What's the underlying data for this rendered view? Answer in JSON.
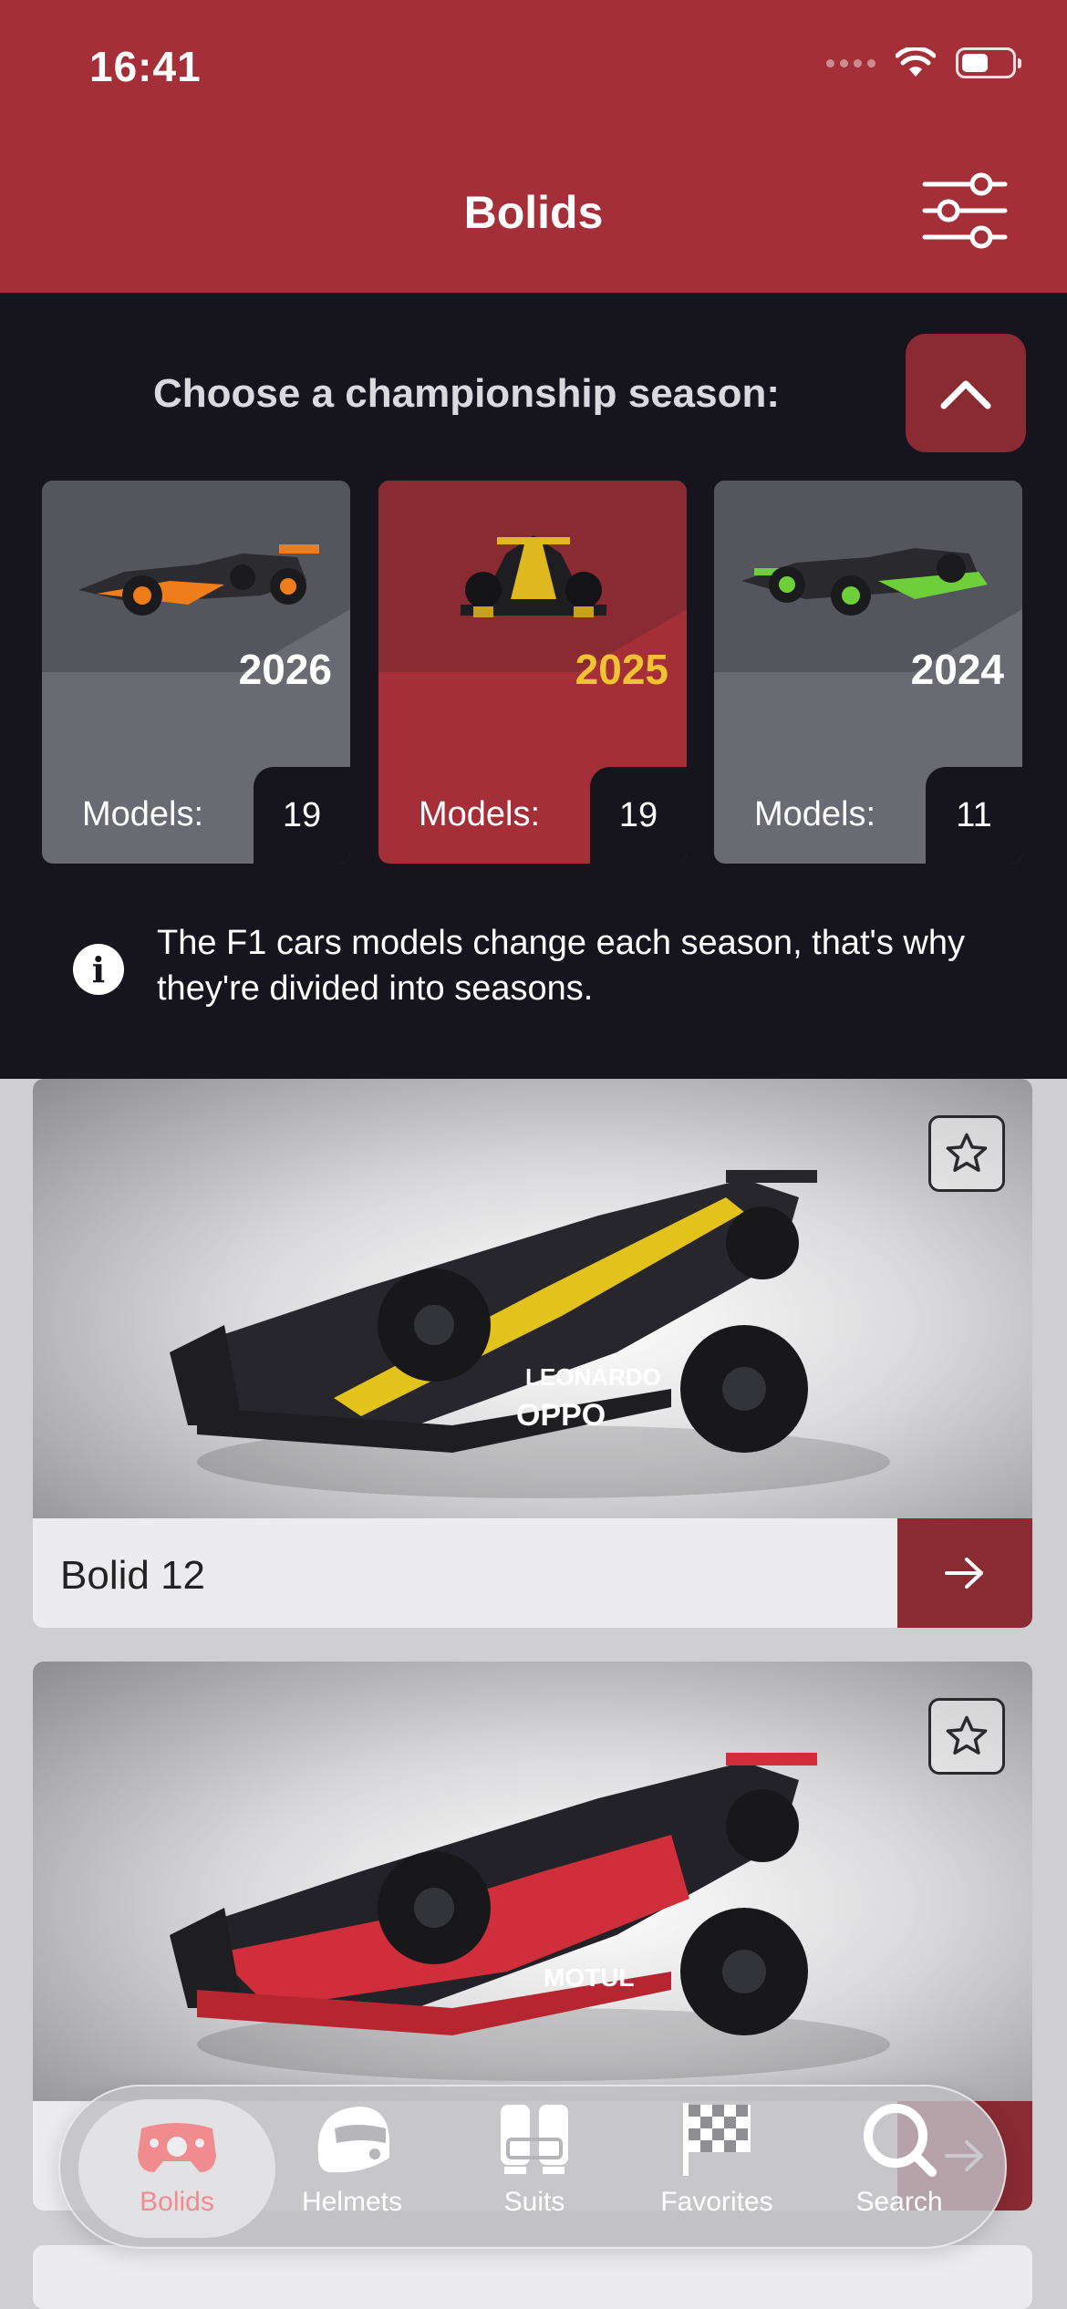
{
  "status_bar": {
    "time": "16:41"
  },
  "header": {
    "title": "Bolids"
  },
  "season_picker": {
    "prompt": "Choose a championship season:",
    "seasons": [
      {
        "year": "2026",
        "models_label": "Models:",
        "models_count": "19",
        "active": false
      },
      {
        "year": "2025",
        "models_label": "Models:",
        "models_count": "19",
        "active": true
      },
      {
        "year": "2024",
        "models_label": "Models:",
        "models_count": "11",
        "active": false
      }
    ],
    "info": "The F1 cars models change each season, that's why they're divided into seasons."
  },
  "models": [
    {
      "name": "Bolid 12"
    },
    {
      "name": ""
    }
  ],
  "tab_bar": {
    "tabs": [
      {
        "label": "Bolids",
        "icon": "steering-wheel-icon",
        "active": true
      },
      {
        "label": "Helmets",
        "icon": "helmet-icon",
        "active": false
      },
      {
        "label": "Suits",
        "icon": "suit-icon",
        "active": false
      },
      {
        "label": "Favorites",
        "icon": "checkered-flag-icon",
        "active": false
      },
      {
        "label": "Search",
        "icon": "search-icon",
        "active": false
      }
    ]
  },
  "colors": {
    "brand_red": "#a42f38",
    "dark_red": "#8a2a33",
    "panel_dark": "#16151d",
    "active_year": "#f1c232"
  }
}
